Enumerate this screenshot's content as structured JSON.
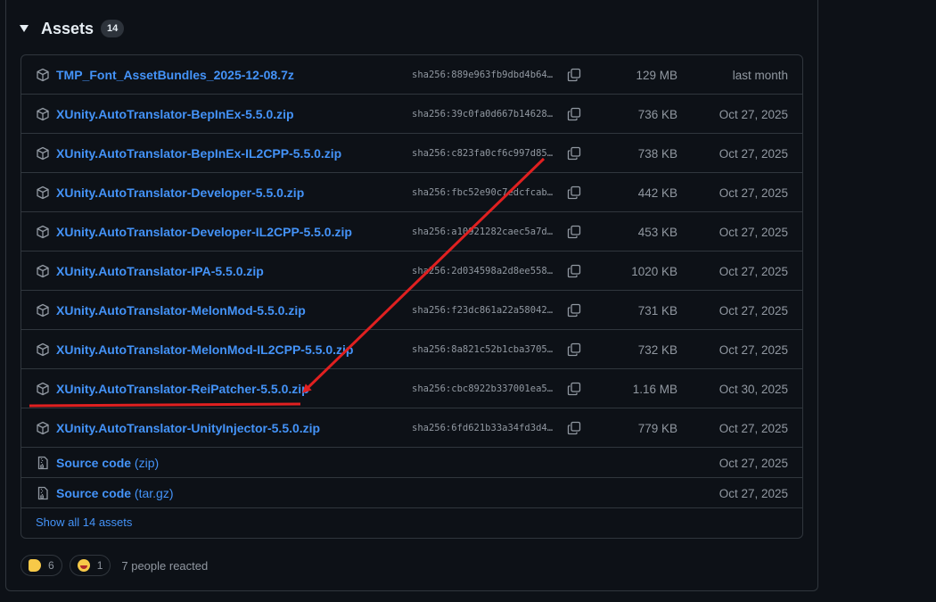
{
  "assets": {
    "title": "Assets",
    "count": "14",
    "show_all_label": "Show all 14 assets",
    "rows": [
      {
        "name": "TMP_Font_AssetBundles_2025-12-08.7z",
        "sha": "sha256:889e963fb9dbd4b64…",
        "size": "129 MB",
        "date": "last month"
      },
      {
        "name": "XUnity.AutoTranslator-BepInEx-5.5.0.zip",
        "sha": "sha256:39c0fa0d667b14628…",
        "size": "736 KB",
        "date": "Oct 27, 2025"
      },
      {
        "name": "XUnity.AutoTranslator-BepInEx-IL2CPP-5.5.0.zip",
        "sha": "sha256:c823fa0cf6c997d85…",
        "size": "738 KB",
        "date": "Oct 27, 2025"
      },
      {
        "name": "XUnity.AutoTranslator-Developer-5.5.0.zip",
        "sha": "sha256:fbc52e90c7edcfcab…",
        "size": "442 KB",
        "date": "Oct 27, 2025"
      },
      {
        "name": "XUnity.AutoTranslator-Developer-IL2CPP-5.5.0.zip",
        "sha": "sha256:a10921282caec5a7d…",
        "size": "453 KB",
        "date": "Oct 27, 2025"
      },
      {
        "name": "XUnity.AutoTranslator-IPA-5.5.0.zip",
        "sha": "sha256:2d034598a2d8ee558…",
        "size": "1020 KB",
        "date": "Oct 27, 2025"
      },
      {
        "name": "XUnity.AutoTranslator-MelonMod-5.5.0.zip",
        "sha": "sha256:f23dc861a22a58042…",
        "size": "731 KB",
        "date": "Oct 27, 2025"
      },
      {
        "name": "XUnity.AutoTranslator-MelonMod-IL2CPP-5.5.0.zip",
        "sha": "sha256:8a821c52b1cba3705…",
        "size": "732 KB",
        "date": "Oct 27, 2025"
      },
      {
        "name": "XUnity.AutoTranslator-ReiPatcher-5.5.0.zip",
        "sha": "sha256:cbc8922b337001ea5…",
        "size": "1.16 MB",
        "date": "Oct 30, 2025"
      },
      {
        "name": "XUnity.AutoTranslator-UnityInjector-5.5.0.zip",
        "sha": "sha256:6fd621b33a34fd3d4…",
        "size": "779 KB",
        "date": "Oct 27, 2025"
      }
    ],
    "source_rows": [
      {
        "name": "Source code",
        "suffix": "(zip)",
        "date": "Oct 27, 2025"
      },
      {
        "name": "Source code",
        "suffix": "(tar.gz)",
        "date": "Oct 27, 2025"
      }
    ]
  },
  "reactions": {
    "items": [
      {
        "emoji": "thumbs-up",
        "count": "6"
      },
      {
        "emoji": "smile",
        "count": "1"
      }
    ],
    "summary": "7 people reacted"
  },
  "colors": {
    "background": "#0d1117",
    "border": "#30363d",
    "link": "#4493f8",
    "muted": "#9198a1",
    "annotation": "#e02020"
  }
}
